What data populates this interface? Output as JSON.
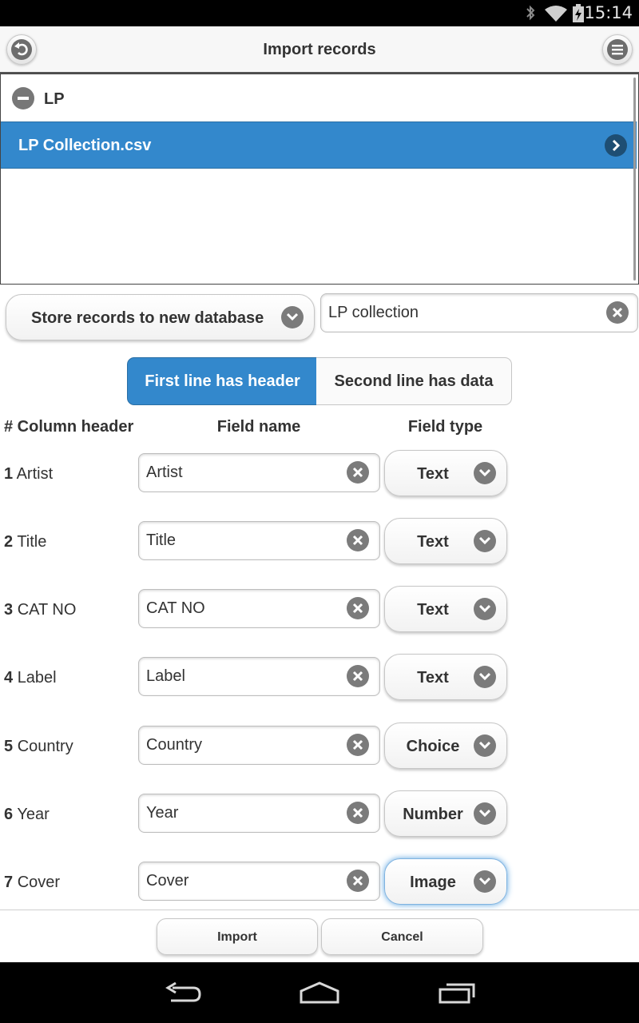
{
  "status_bar": {
    "time": "15:14",
    "icons": [
      "bluetooth-icon",
      "wifi-icon",
      "battery-charging-icon"
    ]
  },
  "header": {
    "title": "Import records",
    "back_icon": "back-arrow-icon",
    "menu_icon": "menu-icon"
  },
  "file_list": {
    "folder": {
      "label": "LP",
      "icon": "collapse-minus-icon"
    },
    "selected_file": {
      "label": "LP Collection.csv",
      "icon": "chevron-right-icon"
    }
  },
  "store": {
    "select_label": "Store records to new database",
    "database_name": "LP collection"
  },
  "header_toggle": {
    "first_label": "First line has header",
    "second_label": "Second line has data",
    "active": "first"
  },
  "columns": {
    "column_header": "# Column header",
    "field_name": "Field name",
    "field_type": "Field type"
  },
  "rows": [
    {
      "num": "1",
      "header": "Artist",
      "field_name": "Artist",
      "field_type": "Text"
    },
    {
      "num": "2",
      "header": "Title",
      "field_name": "Title",
      "field_type": "Text"
    },
    {
      "num": "3",
      "header": "CAT NO",
      "field_name": "CAT NO",
      "field_type": "Text"
    },
    {
      "num": "4",
      "header": "Label",
      "field_name": "Label",
      "field_type": "Text"
    },
    {
      "num": "5",
      "header": "Country",
      "field_name": "Country",
      "field_type": "Choice"
    },
    {
      "num": "6",
      "header": "Year",
      "field_name": "Year",
      "field_type": "Number"
    },
    {
      "num": "7",
      "header": "Cover",
      "field_name": "Cover",
      "field_type": "Image"
    }
  ],
  "footer": {
    "import_label": "Import",
    "cancel_label": "Cancel"
  },
  "colors": {
    "accent": "#3388cc",
    "status_bar": "#000000",
    "icon_gray": "#7b7b7b"
  }
}
